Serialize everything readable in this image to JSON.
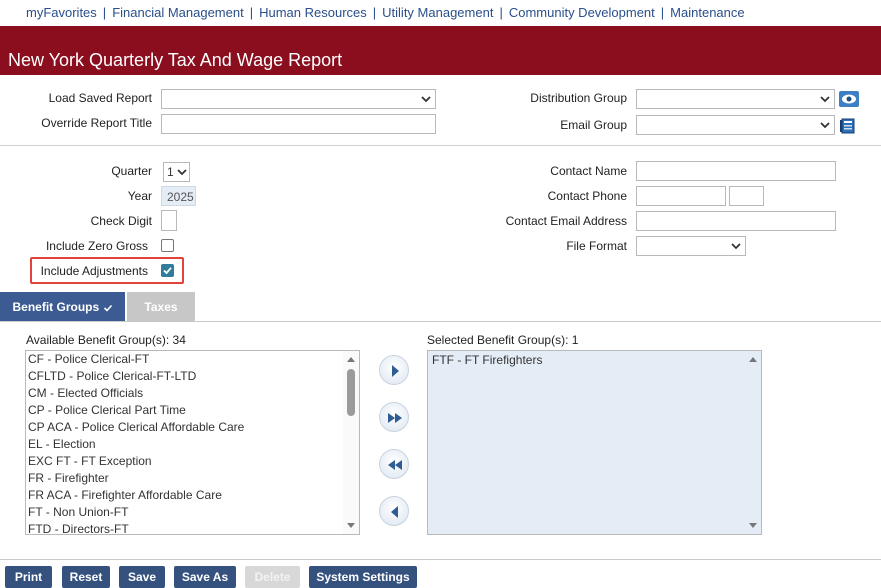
{
  "nav": {
    "items": [
      "myFavorites",
      "Financial Management",
      "Human Resources",
      "Utility Management",
      "Community Development",
      "Maintenance"
    ]
  },
  "page": {
    "title": "New York Quarterly Tax And Wage Report"
  },
  "form": {
    "load_saved_report": {
      "label": "Load Saved Report",
      "value": ""
    },
    "override_report_title": {
      "label": "Override Report Title",
      "value": ""
    },
    "distribution_group": {
      "label": "Distribution Group",
      "value": ""
    },
    "email_group": {
      "label": "Email Group",
      "value": ""
    },
    "quarter": {
      "label": "Quarter",
      "value": "1"
    },
    "year": {
      "label": "Year",
      "value": "2025"
    },
    "check_digit": {
      "label": "Check Digit",
      "value": ""
    },
    "include_zero_gross": {
      "label": "Include Zero Gross",
      "checked": false
    },
    "include_adjustments": {
      "label": "Include Adjustments",
      "checked": true
    },
    "contact_name": {
      "label": "Contact Name",
      "value": ""
    },
    "contact_phone": {
      "label": "Contact Phone",
      "value": "",
      "ext": ""
    },
    "contact_email": {
      "label": "Contact Email Address",
      "value": ""
    },
    "file_format": {
      "label": "File Format",
      "value": ""
    }
  },
  "tabs": {
    "benefit_groups": "Benefit Groups",
    "taxes": "Taxes"
  },
  "available": {
    "header": "Available Benefit Group(s): 34",
    "items": [
      "CF - Police Clerical-FT",
      "CFLTD - Police Clerical-FT-LTD",
      "CM - Elected Officials",
      "CP - Police Clerical Part Time",
      "CP ACA - Police Clerical Affordable Care",
      "EL - Election",
      "EXC FT - FT Exception",
      "FR - Firefighter",
      "FR ACA - Firefighter Affordable Care",
      "FT - Non Union-FT",
      "FTD - Directors-FT"
    ]
  },
  "selected": {
    "header": "Selected Benefit Group(s): 1",
    "items": [
      "FTF - FT Firefighters"
    ]
  },
  "buttons": {
    "print": "Print",
    "reset": "Reset",
    "save": "Save",
    "save_as": "Save As",
    "delete": "Delete",
    "system_settings": "System Settings"
  },
  "colors": {
    "title_bar": "#8b0e1e",
    "nav_link": "#2a4f8a",
    "tab_active": "#3b5b92",
    "button": "#35527f",
    "highlight": "#e2423c",
    "checkbox_checked": "#2f7d9a"
  }
}
